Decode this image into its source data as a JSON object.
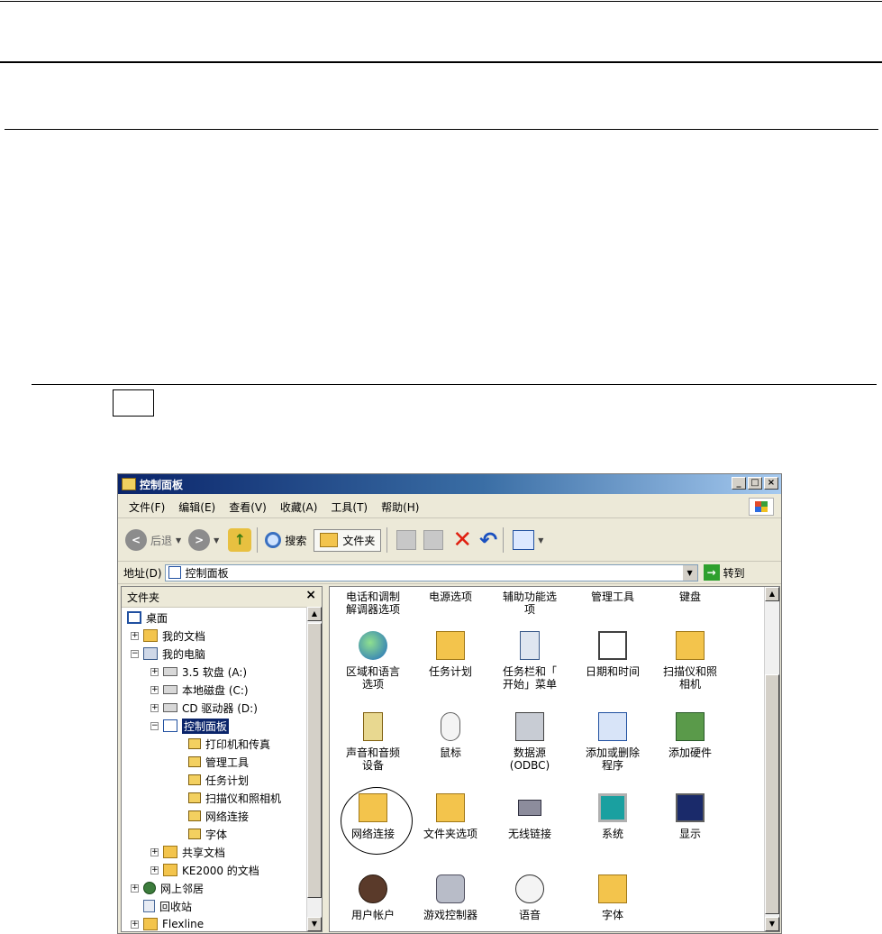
{
  "window": {
    "title": "控制面板",
    "buttons": {
      "minimize": "_",
      "maximize": "□",
      "close": "×"
    }
  },
  "menubar": {
    "items": [
      {
        "label": "文件(F)"
      },
      {
        "label": "编辑(E)"
      },
      {
        "label": "查看(V)"
      },
      {
        "label": "收藏(A)"
      },
      {
        "label": "工具(T)"
      },
      {
        "label": "帮助(H)"
      }
    ]
  },
  "toolbar": {
    "back_label": "后退",
    "search_label": "搜索",
    "folders_label": "文件夹"
  },
  "address": {
    "label": "地址(D)",
    "value": "控制面板",
    "go_label": "转到"
  },
  "folders_pane": {
    "title": "文件夹",
    "close": "×",
    "tree": [
      {
        "label": "桌面",
        "icon": "desktop-icon"
      },
      {
        "label": "我的文档",
        "icon": "folder-icon"
      },
      {
        "label": "我的电脑",
        "icon": "computer-icon"
      },
      {
        "label": "3.5 软盘 (A:)",
        "icon": "floppy-drive-icon"
      },
      {
        "label": "本地磁盘 (C:)",
        "icon": "hard-drive-icon"
      },
      {
        "label": "CD 驱动器 (D:)",
        "icon": "cd-drive-icon"
      },
      {
        "label": "控制面板",
        "icon": "control-panel-icon"
      },
      {
        "label": "打印机和传真",
        "icon": "printers-folder-icon"
      },
      {
        "label": "管理工具",
        "icon": "admin-tools-icon"
      },
      {
        "label": "任务计划",
        "icon": "scheduled-tasks-icon"
      },
      {
        "label": "扫描仪和照相机",
        "icon": "scanner-camera-icon"
      },
      {
        "label": "网络连接",
        "icon": "network-connections-icon"
      },
      {
        "label": "字体",
        "icon": "fonts-folder-icon"
      },
      {
        "label": "共享文档",
        "icon": "folder-icon"
      },
      {
        "label": "KE2000 的文档",
        "icon": "folder-icon"
      },
      {
        "label": "网上邻居",
        "icon": "network-places-icon"
      },
      {
        "label": "回收站",
        "icon": "recycle-bin-icon"
      },
      {
        "label": "Flexline",
        "icon": "folder-icon"
      }
    ]
  },
  "content": {
    "items": [
      {
        "label": "电话和调制\n解调器选项",
        "icon": "phone-modem-icon"
      },
      {
        "label": "电源选项",
        "icon": "power-options-icon"
      },
      {
        "label": "辅助功能选\n项",
        "icon": "accessibility-icon"
      },
      {
        "label": "管理工具",
        "icon": "admin-tools-icon"
      },
      {
        "label": "键盘",
        "icon": "keyboard-icon"
      },
      {
        "label": "区域和语言\n选项",
        "icon": "globe-icon"
      },
      {
        "label": "任务计划",
        "icon": "scheduled-tasks-icon"
      },
      {
        "label": "任务栏和「\n开始」菜单",
        "icon": "taskbar-icon"
      },
      {
        "label": "日期和时间",
        "icon": "calendar-clock-icon"
      },
      {
        "label": "扫描仪和照\n相机",
        "icon": "scanner-camera-icon"
      },
      {
        "label": "声音和音频\n设备",
        "icon": "speaker-icon"
      },
      {
        "label": "鼠标",
        "icon": "mouse-icon"
      },
      {
        "label": "数据源\n(ODBC)",
        "icon": "data-sources-icon"
      },
      {
        "label": "添加或删除\n程序",
        "icon": "add-remove-programs-icon"
      },
      {
        "label": "添加硬件",
        "icon": "add-hardware-icon"
      },
      {
        "label": "网络连接",
        "icon": "network-connections-icon"
      },
      {
        "label": "文件夹选项",
        "icon": "folder-options-icon"
      },
      {
        "label": "无线链接",
        "icon": "wireless-link-icon"
      },
      {
        "label": "系统",
        "icon": "system-icon"
      },
      {
        "label": "显示",
        "icon": "display-icon"
      },
      {
        "label": "用户帐户",
        "icon": "user-accounts-icon"
      },
      {
        "label": "游戏控制器",
        "icon": "game-controllers-icon"
      },
      {
        "label": "语音",
        "icon": "speech-icon"
      },
      {
        "label": "字体",
        "icon": "fonts-folder-icon"
      }
    ]
  }
}
